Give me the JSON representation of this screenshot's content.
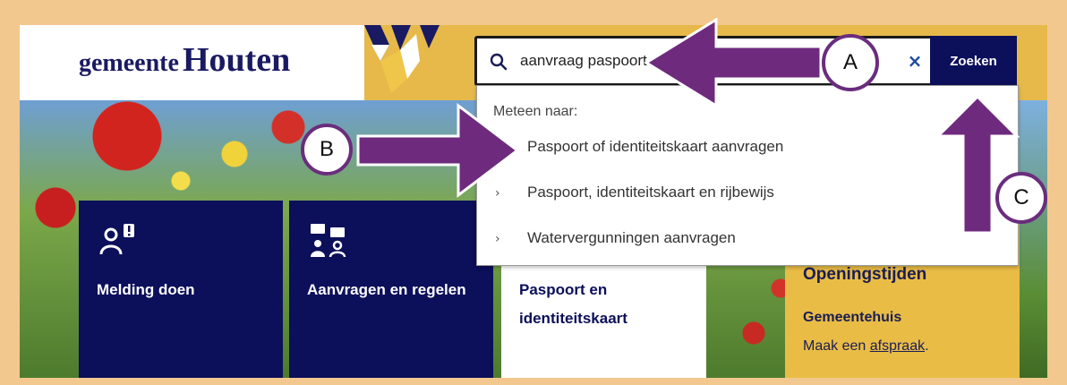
{
  "logo": {
    "prefix": "gemeente",
    "name": "Houten"
  },
  "search": {
    "value": "aanvraag paspoort",
    "clear_label": "×",
    "button_label": "Zoeken"
  },
  "suggestions": {
    "heading": "Meteen naar:",
    "items": [
      {
        "label": "Paspoort of identiteitskaart aanvragen",
        "chevron": ""
      },
      {
        "label": "Paspoort, identiteitskaart en rijbewijs",
        "chevron": "›"
      },
      {
        "label": "Watervergunningen aanvragen",
        "chevron": "›"
      }
    ]
  },
  "tiles": [
    {
      "label": "Melding doen",
      "icon": "person-alert-icon"
    },
    {
      "label": "Aanvragen en regelen",
      "icon": "people-chat-icon"
    },
    {
      "label": "Paspoort en identiteitskaart"
    }
  ],
  "hours": {
    "title": "Openingstijden",
    "subtitle": "Gemeentehuis",
    "text_before": "Maak een ",
    "link": "afspraak",
    "text_after": "."
  },
  "annotations": {
    "a": "A",
    "b": "B",
    "c": "C"
  },
  "colors": {
    "navy": "#0c0f5a",
    "gold": "#e6b94a",
    "arrow": "#6e2b7e",
    "frame": "#f2c88e"
  }
}
